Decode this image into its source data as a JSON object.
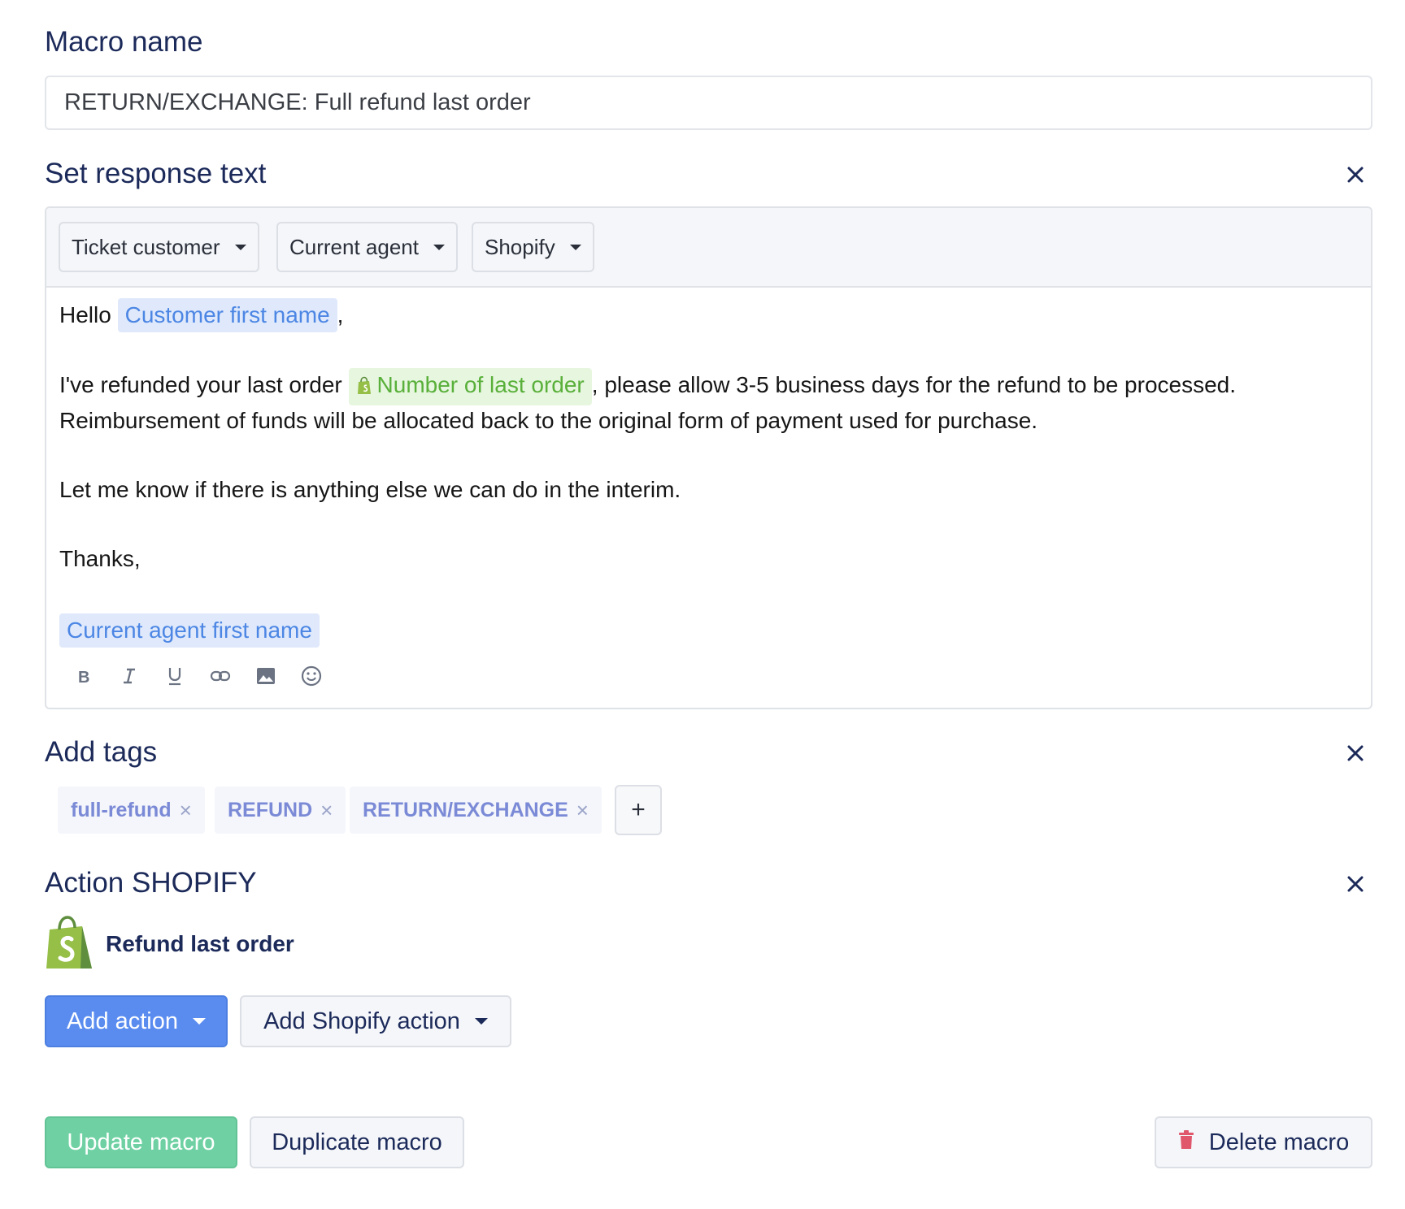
{
  "macro": {
    "name_label": "Macro name",
    "name_value": "RETURN/EXCHANGE: Full refund last order"
  },
  "response": {
    "label": "Set response text",
    "variables": [
      {
        "label": "Ticket customer"
      },
      {
        "label": "Current agent"
      },
      {
        "label": "Shopify"
      }
    ],
    "body": {
      "greeting": "Hello",
      "customer_var": "Customer first name",
      "comma": ",",
      "line2_pre": "I've refunded your last order",
      "order_var": "Number of last order",
      "line2_post": ", please allow 3-5 business days for the refund to be processed.",
      "line3": "Reimbursement of funds will be allocated back to the original form of payment used for purchase.",
      "line4": "Let me know if there is anything else we can do in the interim.",
      "line5": "Thanks,",
      "agent_var": "Current agent first name"
    },
    "format_tools": [
      "bold-icon",
      "italic-icon",
      "underline-icon",
      "link-icon",
      "image-icon",
      "emoji-icon"
    ]
  },
  "tags": {
    "label": "Add tags",
    "items": [
      {
        "label": "full-refund",
        "remove": "×"
      },
      {
        "label": "REFUND",
        "remove": "×"
      },
      {
        "label": "RETURN/EXCHANGE",
        "remove": "×"
      }
    ],
    "add_label": "+"
  },
  "action": {
    "label": "Action SHOPIFY",
    "item": "Refund last order",
    "add_action": "Add action",
    "add_shopify_action": "Add Shopify action"
  },
  "footer": {
    "update": "Update macro",
    "duplicate": "Duplicate macro",
    "delete": "Delete macro"
  },
  "colors": {
    "primary": "#5a8cf0",
    "success": "#6fd1a3",
    "heading": "#1c2a5a",
    "variable_blue": "#4c86e4",
    "variable_green": "#59b03a",
    "danger": "#e0566b"
  }
}
